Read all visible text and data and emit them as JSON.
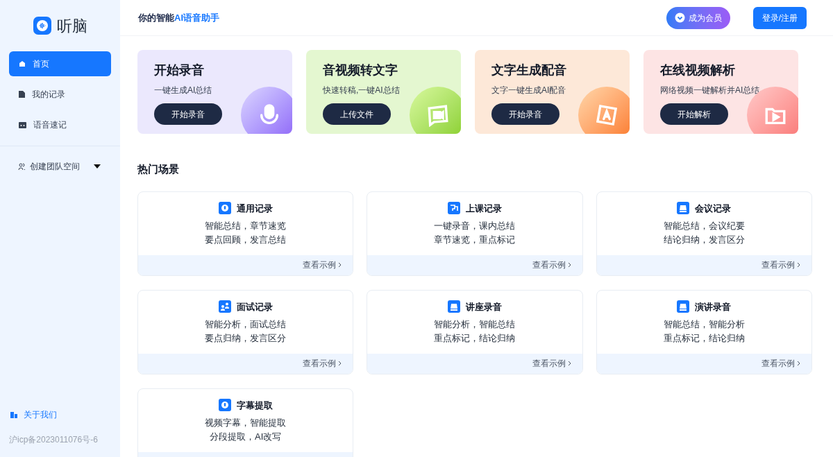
{
  "sidebar": {
    "logo": "听脑",
    "nav": [
      {
        "label": "首页",
        "kind": "home",
        "selected": true
      },
      {
        "label": "我的记录",
        "kind": "doc",
        "selected": false
      },
      {
        "label": "语音速记",
        "kind": "tape",
        "selected": false
      }
    ],
    "team": {
      "label": "创建团队空间",
      "expanded": false
    },
    "about": "关于我们",
    "icp": "沪icp备2023011076号-6"
  },
  "header": {
    "title_dark": "你的智能",
    "title_blue": "AI语音助手",
    "member": "成为会员",
    "login": "登录/注册"
  },
  "features": [
    {
      "title": "开始录音",
      "subtitle": "一键生成AI总结",
      "button": "开始录音",
      "kind": "mic"
    },
    {
      "title": "音视频转文字",
      "subtitle": "快速转稿,一键AI总结",
      "button": "上传文件",
      "kind": "video"
    },
    {
      "title": "文字生成配音",
      "subtitle": "文字一键生成AI配音",
      "button": "开始录音",
      "kind": "text"
    },
    {
      "title": "在线视频解析",
      "subtitle": "网络视频一键解析并AI总结",
      "button": "开始解析",
      "kind": "play"
    }
  ],
  "scenes_title": "热门场景",
  "scenes": [
    {
      "title": "通用记录",
      "kind": "mic",
      "lines": [
        "智能总结，章节速览",
        "要点回顾，发言总结"
      ],
      "link": "查看示例"
    },
    {
      "title": "上课记录",
      "kind": "class",
      "lines": [
        "一键录音，课内总结",
        "章节速览，重点标记"
      ],
      "link": "查看示例"
    },
    {
      "title": "会议记录",
      "kind": "meeting",
      "lines": [
        "智能总结，会议纪要",
        "结论归纳，发言区分"
      ],
      "link": "查看示例"
    },
    {
      "title": "面试记录",
      "kind": "people",
      "lines": [
        "智能分析，面试总结",
        "要点归纳，发言区分"
      ],
      "link": "查看示例"
    },
    {
      "title": "讲座录音",
      "kind": "meeting",
      "lines": [
        "智能分析，智能总结",
        "重点标记，结论归纳"
      ],
      "link": "查看示例"
    },
    {
      "title": "演讲录音",
      "kind": "meeting",
      "lines": [
        "智能总结，智能分析",
        "重点标记，结论归纳"
      ],
      "link": "查看示例"
    },
    {
      "title": "字幕提取",
      "kind": "mic",
      "lines": [
        "视频字幕，智能提取",
        "分段提取，AI改写"
      ]
    }
  ]
}
